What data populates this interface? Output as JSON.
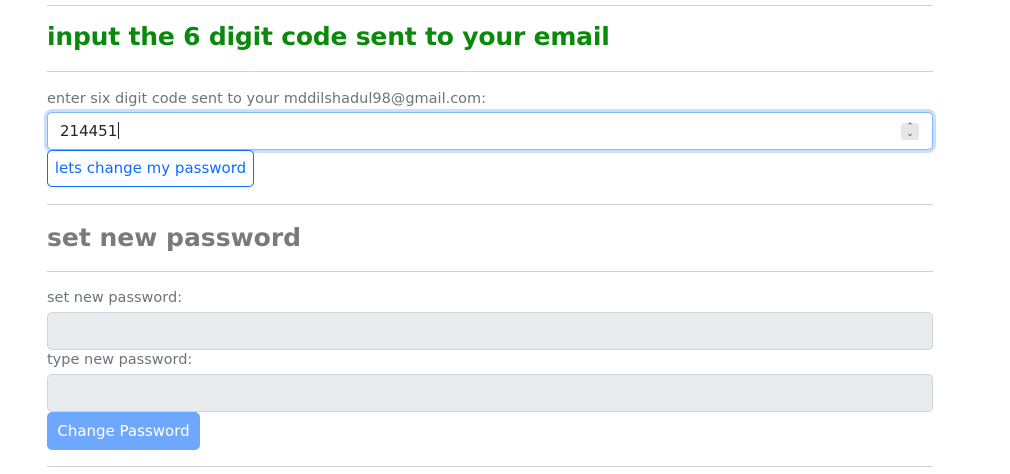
{
  "verify": {
    "heading": "input the 6 digit code sent to your email",
    "label": "enter six digit code sent to your mddilshadul98@gmail.com:",
    "code_value": "214451",
    "submit_label": "lets change my password"
  },
  "reset": {
    "heading": "set new password",
    "new_password_label": "set new password:",
    "confirm_password_label": "type new password:",
    "submit_label": "Change Password"
  },
  "colors": {
    "heading_green": "#0a8a0a",
    "primary_blue": "#0d6efd",
    "disabled_button": "#6ea8fe",
    "disabled_input": "#e9ecef"
  },
  "icons": {
    "spinner": "number-spinner-icon"
  }
}
